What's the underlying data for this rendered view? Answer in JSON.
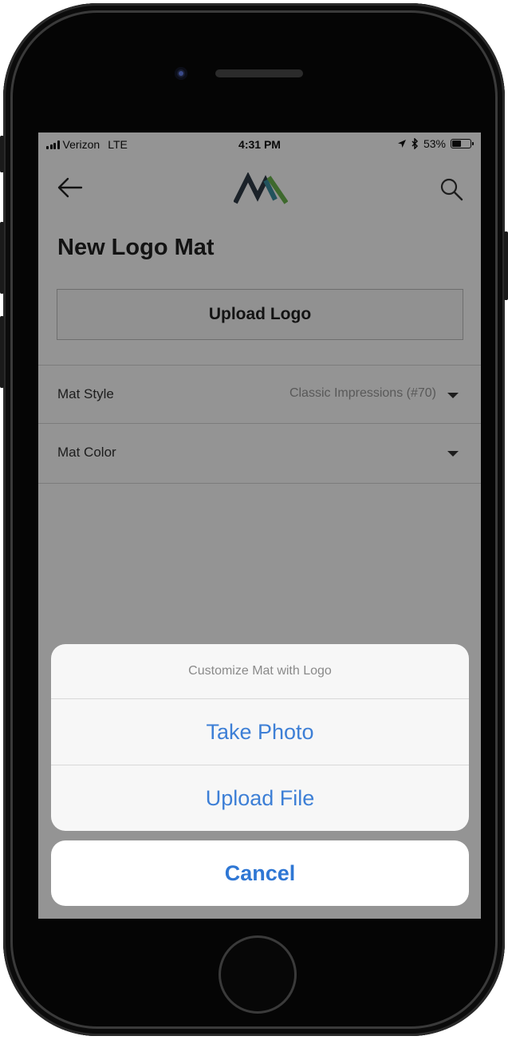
{
  "status_bar": {
    "carrier": "Verizon",
    "network": "LTE",
    "time": "4:31 PM",
    "battery_percent": "53%",
    "battery_level": 0.53,
    "icons": [
      "signal-icon",
      "location-arrow-icon",
      "bluetooth-icon",
      "battery-icon"
    ]
  },
  "navbar": {
    "back_icon": "back-arrow-icon",
    "logo_icon": "brand-logo-icon",
    "search_icon": "search-icon",
    "logo_colors": [
      "#2f3b47",
      "#3b8fa0",
      "#6cb64f"
    ]
  },
  "page": {
    "title": "New Logo Mat",
    "upload_button": "Upload Logo",
    "rows": [
      {
        "label": "Mat Style",
        "value": "Classic Impressions (#70)"
      },
      {
        "label": "Mat Color",
        "value": ""
      }
    ]
  },
  "action_sheet": {
    "title": "Customize Mat with Logo",
    "actions": [
      "Take Photo",
      "Upload File"
    ],
    "cancel": "Cancel",
    "action_color": "#3d7fd6"
  }
}
